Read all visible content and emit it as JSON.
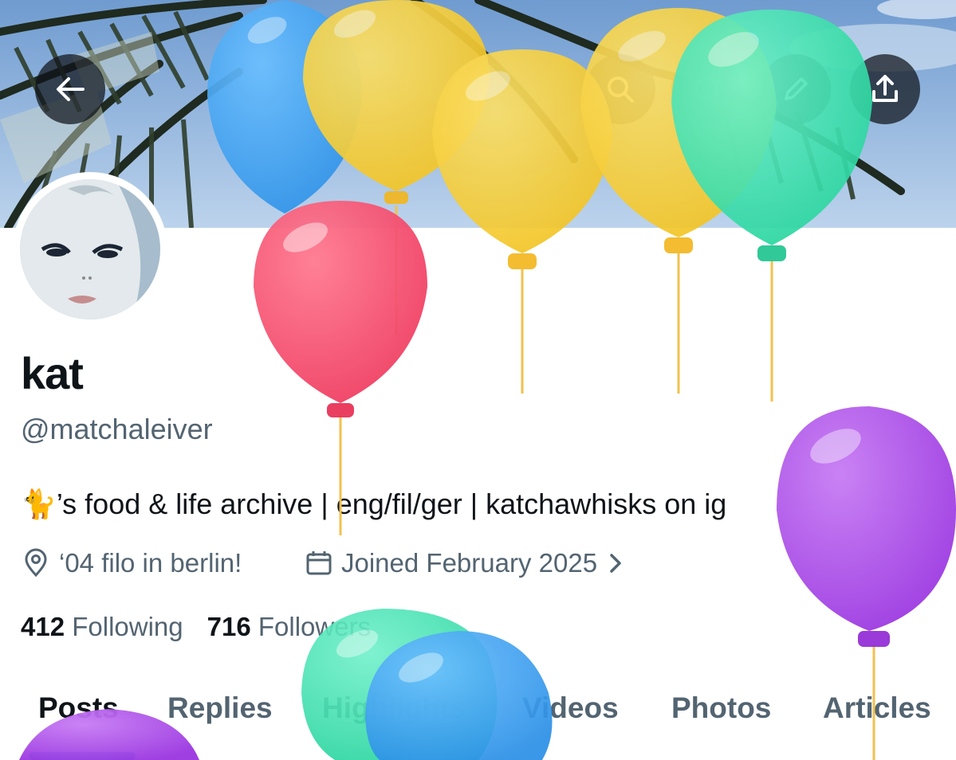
{
  "banner": {
    "image": "palm-leaves-sky-photo"
  },
  "toolbar": {
    "back_icon": "arrow-left-icon",
    "icons": [
      "search-icon",
      "circle-icon",
      "pencil-icon",
      "share-upload-icon"
    ]
  },
  "profile": {
    "name": "kat",
    "handle": "@matchaleiver",
    "bio_emoji": "🐈",
    "bio_text": "’s food & life archive | eng/fil/ger | katchawhisks on ig",
    "location": "‘04 filo in berlin!",
    "joined": "Joined February 2025",
    "following_count": "412",
    "following_label": "Following",
    "followers_count": "716",
    "followers_label": "Followers"
  },
  "tabs": [
    "Posts",
    "Replies",
    "Highlights",
    "Videos",
    "Photos",
    "Articles"
  ],
  "active_tab": "Posts",
  "colors": {
    "accent": "#1d9bf0",
    "text_primary": "#0f1419",
    "text_secondary": "#536471",
    "balloon_blue": "#3da1ef",
    "balloon_yellow": "#f6c935",
    "balloon_green": "#3fe0b0",
    "balloon_pink": "#f2506e",
    "balloon_purple": "#a646e6"
  }
}
